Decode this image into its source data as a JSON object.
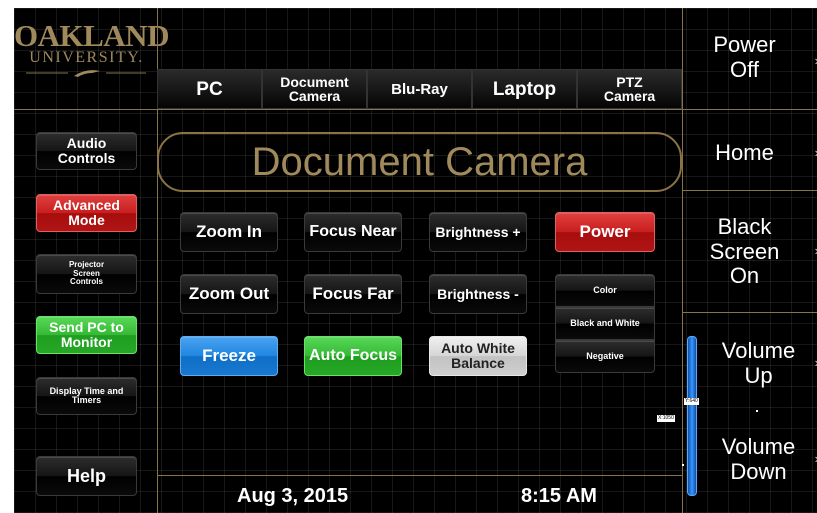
{
  "logo": {
    "main": "OAKLAND",
    "sub": "UNIVERSITY."
  },
  "source_tabs": [
    {
      "label": "PC"
    },
    {
      "label": "Document Camera"
    },
    {
      "label": "Blu-Ray"
    },
    {
      "label": "Laptop"
    },
    {
      "label": "PTZ Camera"
    }
  ],
  "left_menu": {
    "audio": "Audio Controls",
    "advanced": "Advanced Mode",
    "projector": "Projector Screen Controls",
    "send_pc": "Send PC to Monitor",
    "display_time": "Display Time and Timers",
    "help": "Help"
  },
  "main": {
    "title": "Document Camera",
    "zoom_in": "Zoom In",
    "zoom_out": "Zoom Out",
    "freeze": "Freeze",
    "focus_near": "Focus Near",
    "focus_far": "Focus Far",
    "auto_focus": "Auto Focus",
    "brightness_up": "Brightness +",
    "brightness_down": "Brightness -",
    "auto_white": "Auto White Balance",
    "power": "Power",
    "color": "Color",
    "black_white": "Black and White",
    "negative": "Negative"
  },
  "right_menu": {
    "power_off": "Power Off",
    "home": "Home",
    "black_screen": "Black Screen On",
    "volume_up": "Volume Up",
    "volume_down": "Volume Down",
    "chevron": "›"
  },
  "volume": {
    "level": 0.0
  },
  "debug_labels": {
    "a": "Y:640",
    "b": "X:1050"
  },
  "footer": {
    "date": "Aug 3, 2015",
    "time": "8:15 AM"
  },
  "colors": {
    "gold": "#8a7446",
    "red": "#c81e1e",
    "green": "#35b935",
    "blue": "#1f86e0"
  }
}
